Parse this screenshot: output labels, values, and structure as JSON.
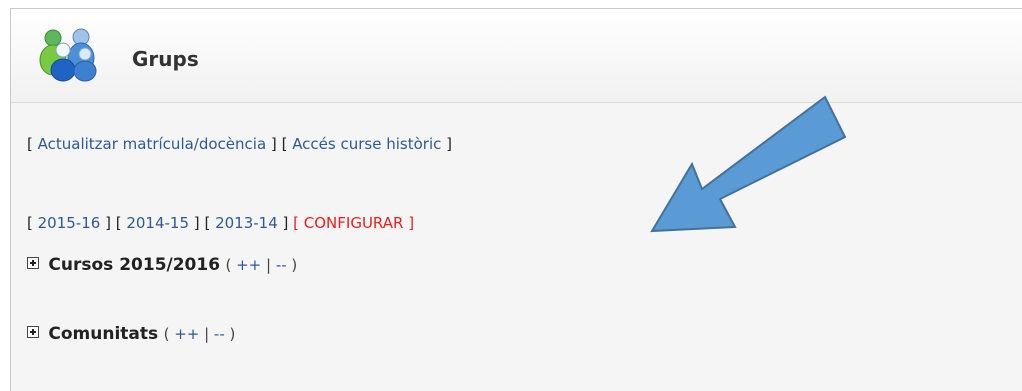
{
  "header": {
    "title": "Grups",
    "icon": "group-users-icon"
  },
  "links_row": [
    {
      "label": "Actualitzar matrícula/docència"
    },
    {
      "label": "Accés curse històric"
    }
  ],
  "years_row": {
    "years": [
      "2015-16",
      "2014-15",
      "2013-14"
    ],
    "configure": "CONFIGURAR"
  },
  "sections": [
    {
      "title": "Cursos 2015/2016",
      "expand": "++",
      "collapse": "--"
    },
    {
      "title": "Comunitats",
      "expand": "++",
      "collapse": "--"
    }
  ],
  "colors": {
    "link": "#2c5a96",
    "configure": "#e8201c",
    "arrow": "#5b9bd5"
  }
}
